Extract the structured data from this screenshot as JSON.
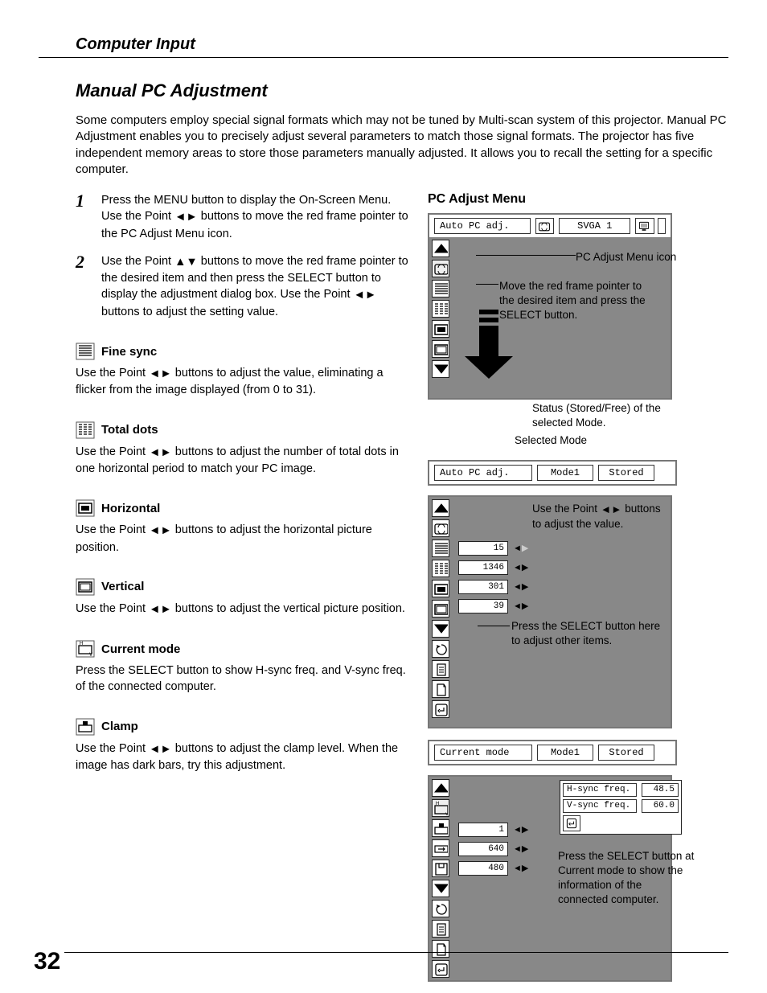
{
  "section_title": "Computer Input",
  "page_title": "Manual PC Adjustment",
  "intro": "Some computers employ special signal formats which may not be tuned by Multi-scan system of this projector. Manual PC Adjustment enables you to precisely adjust several parameters to match those signal formats. The projector has five independent memory areas to store those parameters manually adjusted. It allows you to recall the setting for a specific computer.",
  "step1_pre": "Press the MENU button to display the On-Screen Menu. Use the Point ",
  "step1_post": " buttons to move the red frame pointer to the PC Adjust Menu icon.",
  "step2_pre": "Use the Point ",
  "step2_mid": " buttons to move the red frame pointer to the desired item and then press the SELECT button to display the adjustment dialog box. Use the Point ",
  "step2_post": " buttons to adjust the setting value.",
  "items": {
    "fine_sync": {
      "label": "Fine sync",
      "desc_pre": "Use the Point ",
      "desc_post": " buttons to adjust the value, eliminating a flicker from the image displayed (from 0 to 31)."
    },
    "total_dots": {
      "label": "Total dots",
      "desc_pre": "Use the Point ",
      "desc_post": " buttons to adjust the number of total dots in one horizontal period to match your PC image."
    },
    "horizontal": {
      "label": "Horizontal",
      "desc_pre": "Use the Point ",
      "desc_post": " buttons to adjust the horizontal picture position."
    },
    "vertical": {
      "label": "Vertical",
      "desc_pre": "Use the Point ",
      "desc_post": " buttons to adjust the vertical picture position."
    },
    "current_mode": {
      "label": "Current mode",
      "desc": "Press the SELECT button to show H-sync freq. and V-sync freq. of the connected computer."
    },
    "clamp": {
      "label": "Clamp",
      "desc_pre": "Use the Point ",
      "desc_post": " buttons to adjust the clamp level. When the image has dark bars, try this adjustment."
    }
  },
  "right_title": "PC Adjust Menu",
  "osd1": {
    "top_label": "Auto PC adj.",
    "sys_label": "SVGA 1"
  },
  "notes": {
    "icon": "PC Adjust Menu icon",
    "move": "Move the red frame pointer to the desired item and press the SELECT button.",
    "status": "Status (Stored/Free) of the selected Mode.",
    "selmode": "Selected Mode",
    "adjust_pre": "Use the Point ",
    "adjust_post": " buttons to adjust the value.",
    "other": "Press the SELECT button here to adjust other items.",
    "curmode": "Press the SELECT button at Current mode to show the information of the connected computer."
  },
  "bar2": {
    "left": "Auto PC adj.",
    "mid": "Mode1",
    "right": "Stored"
  },
  "bar3": {
    "left": "Current mode",
    "mid": "Mode1",
    "right": "Stored"
  },
  "osd2": {
    "values": [
      "15",
      "1346",
      "301",
      "39"
    ]
  },
  "osd3": {
    "values": [
      "1",
      "640",
      "480"
    ],
    "hs_label": "H-sync freq.",
    "hs_val": "48.5",
    "vs_label": "V-sync freq.",
    "vs_val": "60.0"
  },
  "page_number": "32"
}
